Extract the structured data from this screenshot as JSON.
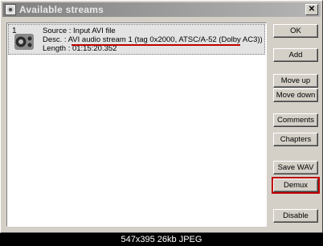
{
  "window": {
    "title": "Available streams",
    "close_glyph": "✕"
  },
  "stream": {
    "index": "1",
    "source_line": "Source : Input AVI file",
    "desc_line": "Desc. : AVI audio stream 1 (tag 0x2000, ATSC/A-52 (Dolby AC3))",
    "length_line": "Length : 01:15:20.352",
    "icon": "audio-speaker-icon"
  },
  "buttons": {
    "ok": "OK",
    "add": "Add",
    "move_up": "Move up",
    "move_down": "Move down",
    "comments": "Comments",
    "chapters": "Chapters",
    "save_wav": "Save WAV",
    "demux": "Demux",
    "disable": "Disable"
  },
  "status_bar": {
    "text": "547x395 26kb JPEG"
  },
  "colors": {
    "highlight": "#c00000",
    "dialog_bg": "#d4d0c8",
    "selected_row": "#e3e3e3"
  }
}
